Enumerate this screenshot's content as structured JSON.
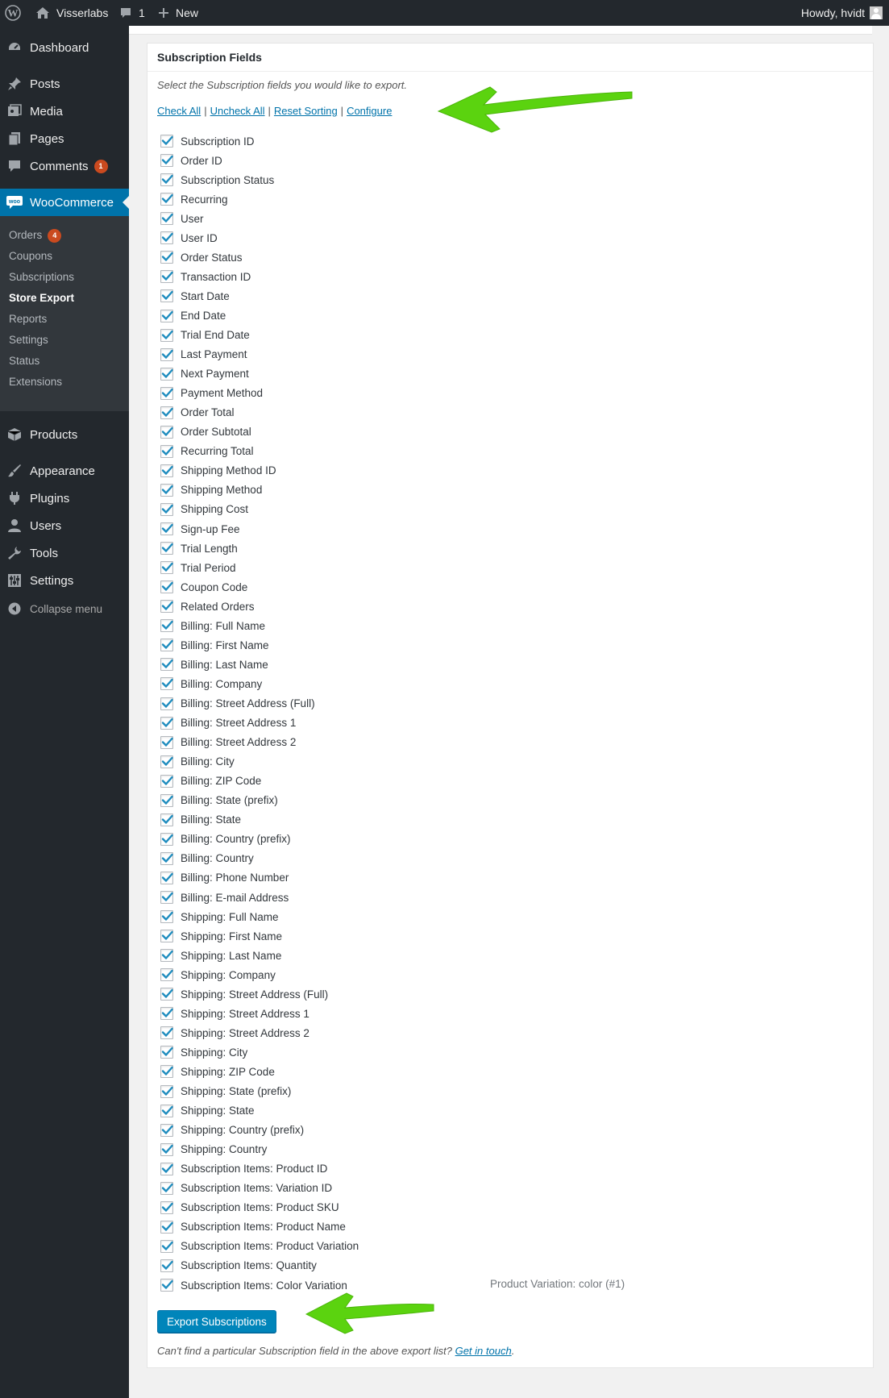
{
  "admin_bar": {
    "site_name": "Visserlabs",
    "comments_count": "1",
    "new_label": "New",
    "howdy": "Howdy, hvidt"
  },
  "sidebar": {
    "items": [
      {
        "label": "Dashboard",
        "icon": "dashboard-icon"
      },
      {
        "label": "Posts",
        "icon": "pin-icon"
      },
      {
        "label": "Media",
        "icon": "media-icon"
      },
      {
        "label": "Pages",
        "icon": "pages-icon"
      },
      {
        "label": "Comments",
        "icon": "comment-icon",
        "badge": "1"
      },
      {
        "label": "WooCommerce",
        "icon": "woo-icon",
        "active": true
      },
      {
        "label": "Products",
        "icon": "box-icon"
      },
      {
        "label": "Appearance",
        "icon": "brush-icon"
      },
      {
        "label": "Plugins",
        "icon": "plug-icon"
      },
      {
        "label": "Users",
        "icon": "user-icon"
      },
      {
        "label": "Tools",
        "icon": "wrench-icon"
      },
      {
        "label": "Settings",
        "icon": "settings-icon"
      }
    ],
    "submenu": [
      {
        "label": "Orders",
        "badge": "4"
      },
      {
        "label": "Coupons"
      },
      {
        "label": "Subscriptions"
      },
      {
        "label": "Store Export",
        "current": true
      },
      {
        "label": "Reports"
      },
      {
        "label": "Settings"
      },
      {
        "label": "Status"
      },
      {
        "label": "Extensions"
      }
    ],
    "collapse_label": "Collapse menu"
  },
  "panel": {
    "title": "Subscription Fields",
    "description": "Select the Subscription fields you would like to export.",
    "links": {
      "check_all": "Check All",
      "uncheck_all": "Uncheck All",
      "reset_sorting": "Reset Sorting",
      "configure": "Configure",
      "separator": "|"
    },
    "fields": [
      "Subscription ID",
      "Order ID",
      "Subscription Status",
      "Recurring",
      "User",
      "User ID",
      "Order Status",
      "Transaction ID",
      "Start Date",
      "End Date",
      "Trial End Date",
      "Last Payment",
      "Next Payment",
      "Payment Method",
      "Order Total",
      "Order Subtotal",
      "Recurring Total",
      "Shipping Method ID",
      "Shipping Method",
      "Shipping Cost",
      "Sign-up Fee",
      "Trial Length",
      "Trial Period",
      "Coupon Code",
      "Related Orders",
      "Billing: Full Name",
      "Billing: First Name",
      "Billing: Last Name",
      "Billing: Company",
      "Billing: Street Address (Full)",
      "Billing: Street Address 1",
      "Billing: Street Address 2",
      "Billing: City",
      "Billing: ZIP Code",
      "Billing: State (prefix)",
      "Billing: State",
      "Billing: Country (prefix)",
      "Billing: Country",
      "Billing: Phone Number",
      "Billing: E-mail Address",
      "Shipping: Full Name",
      "Shipping: First Name",
      "Shipping: Last Name",
      "Shipping: Company",
      "Shipping: Street Address (Full)",
      "Shipping: Street Address 1",
      "Shipping: Street Address 2",
      "Shipping: City",
      "Shipping: ZIP Code",
      "Shipping: State (prefix)",
      "Shipping: State",
      "Shipping: Country (prefix)",
      "Shipping: Country",
      "Subscription Items: Product ID",
      "Subscription Items: Variation ID",
      "Subscription Items: Product SKU",
      "Subscription Items: Product Name",
      "Subscription Items: Product Variation",
      "Subscription Items: Quantity",
      "Subscription Items: Color Variation"
    ],
    "all_checked": true,
    "last_field_note": "Product Variation: color (#1)",
    "export_button": "Export Subscriptions",
    "footer_text": "Can't find a particular Subscription field in the above export list?",
    "footer_link": "Get in touch",
    "footer_end": "."
  },
  "colors": {
    "admin_dark": "#23282d",
    "accent": "#0073aa",
    "button": "#0085ba",
    "badge": "#ca4a1f",
    "arrow": "#5bd30f"
  }
}
